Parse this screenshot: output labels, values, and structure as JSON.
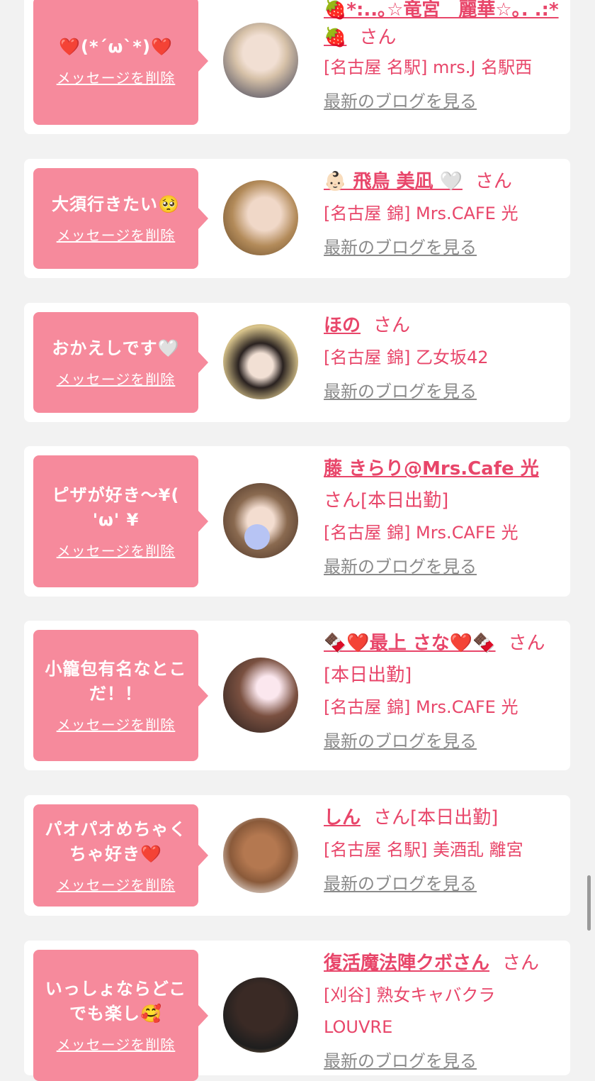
{
  "delete_label": "メッセージを削除",
  "blog_label": "最新のブログを見る",
  "san_label": "さん",
  "colors": {
    "accent": "#e8466a",
    "bubble": "#f68a9c",
    "background": "#f2f2f2"
  },
  "cards": [
    {
      "message": "❤️(*´ω`*)❤️",
      "name_line1": "🍓*:..｡☆竜宮　麗華☆｡. .:*",
      "name_line2": "🍓",
      "san_suffix": "",
      "shop": "[名古屋 名駅] mrs.J 名駅西",
      "avatar_icon": "girl-photo"
    },
    {
      "message": "大須行きたい🥺",
      "name_line1": "👶🏻 飛鳥 美凪 🤍",
      "name_line2": "",
      "san_suffix": "",
      "shop": "[名古屋 錦] Mrs.CAFE 光",
      "avatar_icon": "girl-photo"
    },
    {
      "message": "おかえしです🤍",
      "name_line1": "ほの",
      "name_line2": "",
      "san_suffix": "",
      "shop": "[名古屋 錦] 乙女坂42",
      "avatar_icon": "girl-photo"
    },
    {
      "message": "ピザが好き〜¥( 'ω' ¥",
      "name_line1": "藤 きらり@Mrs.Cafe 光",
      "name_line2": "",
      "san_suffix": "[本日出勤]",
      "shop": "[名古屋 錦] Mrs.CAFE 光",
      "avatar_icon": "girl-photo"
    },
    {
      "message": "小籠包有名なとこだ！！",
      "name_line1": "🍫❤️最上 さな❤️🍫",
      "name_line2": "",
      "san_suffix": "[本日出勤]",
      "shop": "[名古屋 錦] Mrs.CAFE 光",
      "avatar_icon": "girl-photo"
    },
    {
      "message": "パオパオめちゃくちゃ好き❤️",
      "name_line1": "しん",
      "name_line2": "",
      "san_suffix": "[本日出勤]",
      "shop": "[名古屋 名駅] 美酒乱 離宮",
      "avatar_icon": "girl-photo"
    },
    {
      "message": "いっしょならどこでも楽し🥰",
      "name_line1": "復活魔法陣クボさん",
      "name_line2": "",
      "san_suffix": "",
      "shop": "[刈谷] 熟女キャバクラ LOUVRE",
      "avatar_icon": "girl-photo"
    }
  ]
}
